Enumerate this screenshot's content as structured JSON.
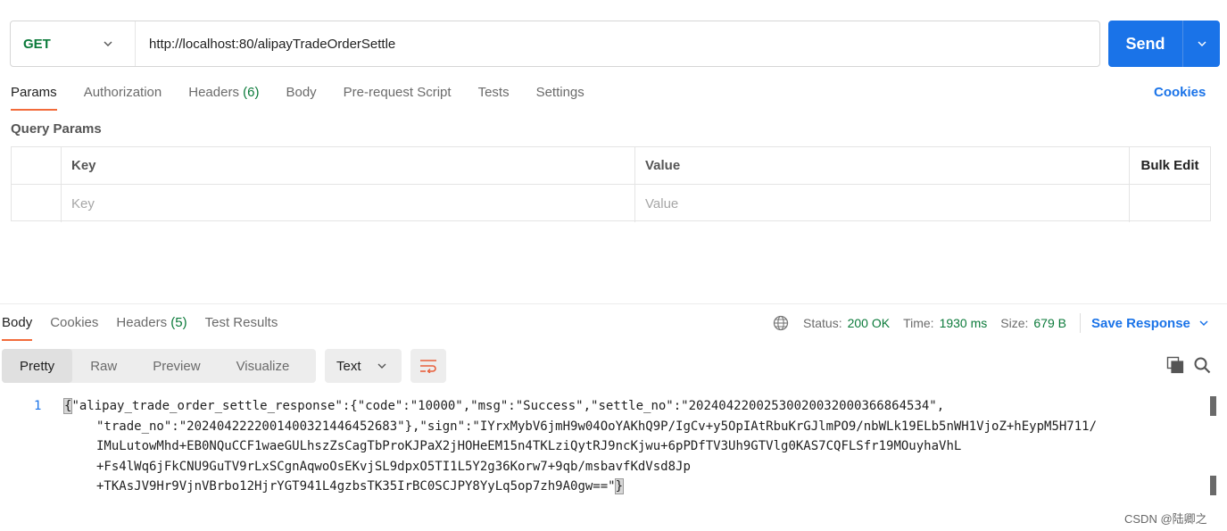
{
  "request": {
    "method": "GET",
    "url": "http://localhost:80/alipayTradeOrderSettle",
    "send_label": "Send"
  },
  "request_tabs": [
    {
      "label": "Params",
      "count": ""
    },
    {
      "label": "Authorization",
      "count": ""
    },
    {
      "label": "Headers",
      "count": "(6)"
    },
    {
      "label": "Body",
      "count": ""
    },
    {
      "label": "Pre-request Script",
      "count": ""
    },
    {
      "label": "Tests",
      "count": ""
    },
    {
      "label": "Settings",
      "count": ""
    }
  ],
  "cookies_link": "Cookies",
  "query_params": {
    "title": "Query Params",
    "headers": {
      "key": "Key",
      "value": "Value",
      "bulk_edit": "Bulk Edit"
    },
    "placeholders": {
      "key": "Key",
      "value": "Value"
    }
  },
  "response_tabs": [
    {
      "label": "Body",
      "count": ""
    },
    {
      "label": "Cookies",
      "count": ""
    },
    {
      "label": "Headers",
      "count": "(5)"
    },
    {
      "label": "Test Results",
      "count": ""
    }
  ],
  "response_meta": {
    "status_label": "Status:",
    "status_value": "200 OK",
    "time_label": "Time:",
    "time_value": "1930 ms",
    "size_label": "Size:",
    "size_value": "679 B",
    "save_label": "Save Response"
  },
  "view_modes": [
    "Pretty",
    "Raw",
    "Preview",
    "Visualize"
  ],
  "format": "Text",
  "code": {
    "line_number": "1",
    "open_brace": "{",
    "line1": "\"alipay_trade_order_settle_response\":{\"code\":\"10000\",\"msg\":\"Success\",\"settle_no\":\"20240422002530020032000366864534\",",
    "line2": "\"trade_no\":\"2024042222001400321446452683\"},\"sign\":\"IYrxMybV6jmH9w04OoYAKhQ9P/IgCv+y5OpIAtRbuKrGJlmPO9/nbWLk19ELb5nWH1VjoZ+hEypM5H711/",
    "line3": "IMuLutowMhd+EB0NQuCCF1waeGULhszZsCagTbProKJPaX2jHOHeEM15n4TKLziQytRJ9ncKjwu+6pPDfTV3Uh9GTVlg0KAS7CQFLSfr19MOuyhaVhL",
    "line4": "+Fs4lWq6jFkCNU9GuTV9rLxSCgnAqwoOsEKvjSL9dpxO5TI1L5Y2g36Korw7+9qb/msbavfKdVsd8Jp",
    "line5": "+TKAsJV9Hr9VjnVBrbo12HjrYGT941L4gzbsTK35IrBC0SCJPY8YyLq5op7zh9A0gw==\"",
    "close_brace": "}"
  },
  "watermark": "CSDN @陆卿之",
  "colors": {
    "accent": "#1a73e8",
    "green": "#0b7a3a",
    "tab_underline": "#f26b3a"
  },
  "icons": [
    "chevron-down-icon",
    "globe-icon",
    "wrap-lines-icon",
    "copy-icon",
    "search-icon"
  ]
}
